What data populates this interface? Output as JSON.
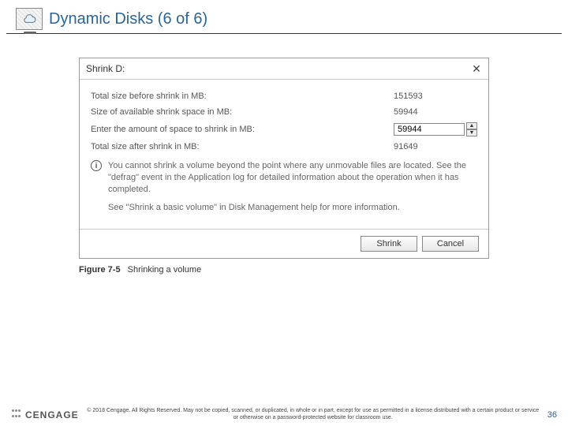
{
  "header": {
    "title": "Dynamic Disks (6 of 6)"
  },
  "dialog": {
    "title": "Shrink D:",
    "rows": {
      "total_before": {
        "label": "Total size before shrink in MB:",
        "value": "151593"
      },
      "available": {
        "label": "Size of available shrink space in MB:",
        "value": "59944"
      },
      "enter_amount": {
        "label": "Enter the amount of space to shrink in MB:",
        "value": "59944"
      },
      "total_after": {
        "label": "Total size after shrink in MB:",
        "value": "91649"
      }
    },
    "info_glyph": "i",
    "info_p1": "You cannot shrink a volume beyond the point where any unmovable files are located. See the \"defrag\" event in the Application log for detailed information about the operation when it has completed.",
    "info_p2": "See \"Shrink a basic volume\" in Disk Management help for more information.",
    "buttons": {
      "shrink": "Shrink",
      "cancel": "Cancel"
    }
  },
  "caption": {
    "figure": "Figure 7-5",
    "text": "Shrinking a volume"
  },
  "footer": {
    "brand": "CENGAGE",
    "copyright": "© 2018 Cengage. All Rights Reserved. May not be copied, scanned, or duplicated, in whole or in part, except for use as permitted in a license distributed with a certain product or service or otherwise on a password-protected website for classroom use.",
    "page": "36"
  }
}
